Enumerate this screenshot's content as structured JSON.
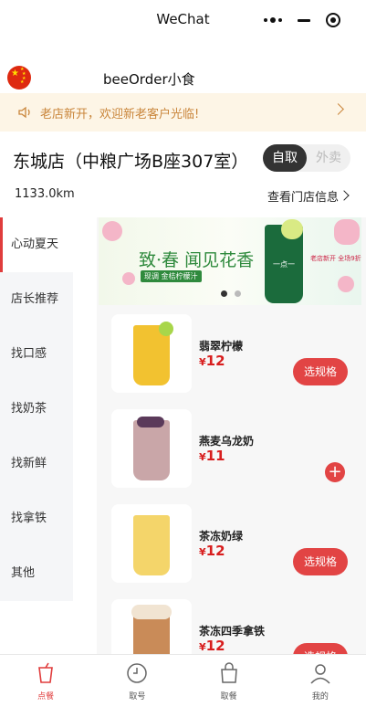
{
  "window": {
    "title": "WeChat"
  },
  "capsule": {
    "more_icon": "more-dots-icon",
    "minimize_icon": "minimize-icon",
    "close_icon": "target-close-icon"
  },
  "brand": {
    "flag_icon": "china-flag-icon",
    "name": "beeOrder小食"
  },
  "notice": {
    "icon": "speaker-icon",
    "text": "老店新开，欢迎新老客户光临!"
  },
  "store": {
    "name": "东城店（中粮广场B座307室）",
    "distance": "1133.0km",
    "info_label": "查看门店信息",
    "mode_options": [
      "自取",
      "外卖"
    ],
    "mode_selected": "自取"
  },
  "categories": [
    "心动夏天",
    "店长推荐",
    "找口感",
    "找奶茶",
    "找新鲜",
    "找拿铁",
    "其他"
  ],
  "active_category": "心动夏天",
  "banner": {
    "title": "致·春 闻见花香",
    "sub": "现调 金桔柠檬汁",
    "cup_text": "一点一",
    "caption": "老店新开 全场9折",
    "slide_count": 2,
    "active_slide": 1
  },
  "products": [
    {
      "name": "翡翠柠檬",
      "currency": "¥",
      "price": "12",
      "action": "选规格",
      "action_type": "spec",
      "color": "#f2c230"
    },
    {
      "name": "燕麦乌龙奶",
      "currency": "¥",
      "price": "11",
      "action": "+",
      "action_type": "add",
      "color": "#c9a6a8"
    },
    {
      "name": "茶冻奶绿",
      "currency": "¥",
      "price": "12",
      "action": "选规格",
      "action_type": "spec",
      "color": "#f4d56a"
    },
    {
      "name": "茶冻四季拿铁",
      "currency": "¥",
      "price": "12",
      "action": "选规格",
      "action_type": "spec",
      "color": "#c98b58"
    }
  ],
  "tabs": [
    {
      "label": "点餐",
      "icon": "cup-icon",
      "active": true
    },
    {
      "label": "取号",
      "icon": "clock-ticket-icon",
      "active": false
    },
    {
      "label": "取餐",
      "icon": "bag-icon",
      "active": false
    },
    {
      "label": "我的",
      "icon": "user-icon",
      "active": false
    }
  ],
  "colors": {
    "accent": "#e03c3c",
    "notice_bg": "#fdf5e6",
    "notice_text": "#c9853a",
    "price": "#d81e1e"
  }
}
